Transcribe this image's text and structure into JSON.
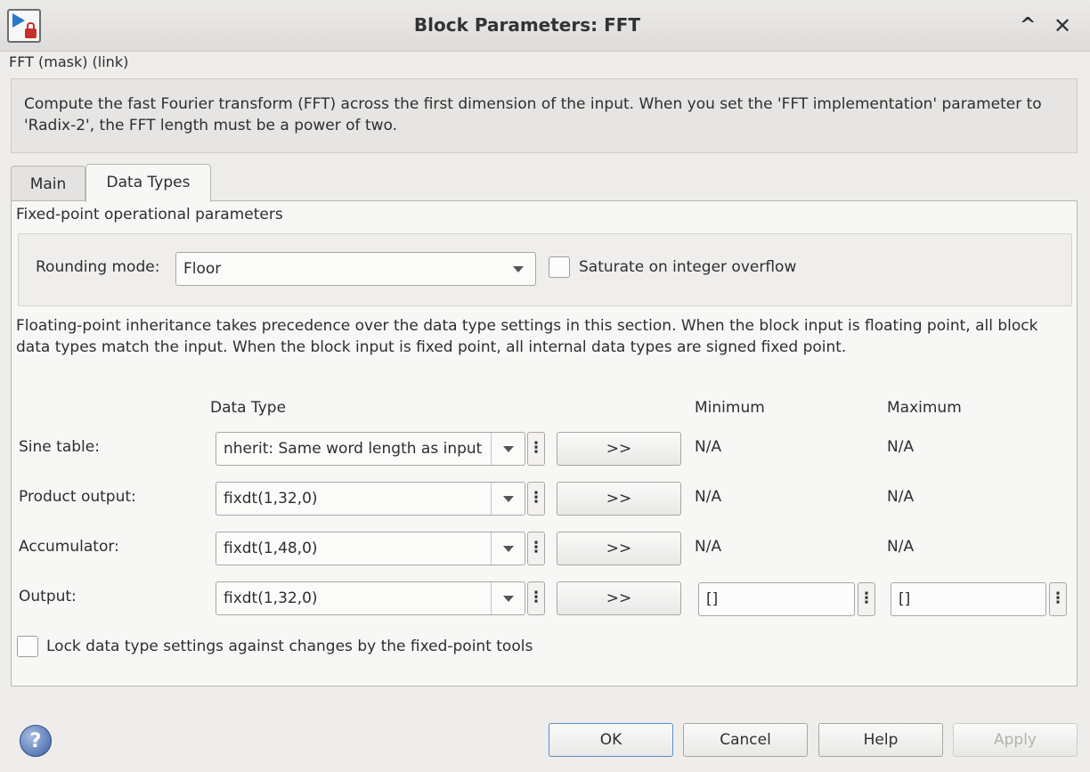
{
  "window": {
    "title": "Block Parameters: FFT",
    "collapse_glyph": "^",
    "close_glyph": "✕"
  },
  "mask_label": "FFT (mask) (link)",
  "description": "Compute the fast Fourier transform (FFT) across the first dimension of the input. When you set the 'FFT implementation' parameter to 'Radix-2', the FFT length must be a power of two.",
  "tabs": [
    {
      "label": "Main",
      "selected": false
    },
    {
      "label": "Data Types",
      "selected": true
    }
  ],
  "fixed_point": {
    "group_title": "Fixed-point operational parameters",
    "rounding_label": "Rounding mode:",
    "rounding_value": "Floor",
    "saturate_label": "Saturate on integer overflow",
    "saturate_checked": false
  },
  "note": "Floating-point inheritance takes precedence over the data type settings in this section. When the block input is floating point, all block data types match the input. When the block input is fixed point, all internal data types are signed fixed point.",
  "columns": {
    "data_type": "Data Type",
    "minimum": "Minimum",
    "maximum": "Maximum"
  },
  "rows": [
    {
      "label": "Sine table:",
      "data_type": "nherit: Same word length as input",
      "assistant": ">>",
      "minimum": "N/A",
      "maximum": "N/A"
    },
    {
      "label": "Product output:",
      "data_type": "fixdt(1,32,0)",
      "assistant": ">>",
      "minimum": "N/A",
      "maximum": "N/A"
    },
    {
      "label": "Accumulator:",
      "data_type": "fixdt(1,48,0)",
      "assistant": ">>",
      "minimum": "N/A",
      "maximum": "N/A"
    },
    {
      "label": "Output:",
      "data_type": "fixdt(1,32,0)",
      "assistant": ">>",
      "minimum": "[]",
      "maximum": "[]"
    }
  ],
  "lock": {
    "label": "Lock data type settings against changes by the fixed-point tools",
    "checked": false
  },
  "buttons": {
    "ok": "OK",
    "cancel": "Cancel",
    "help": "Help",
    "apply": "Apply"
  },
  "help_icon_glyph": "?",
  "dots_glyph": "⋮"
}
